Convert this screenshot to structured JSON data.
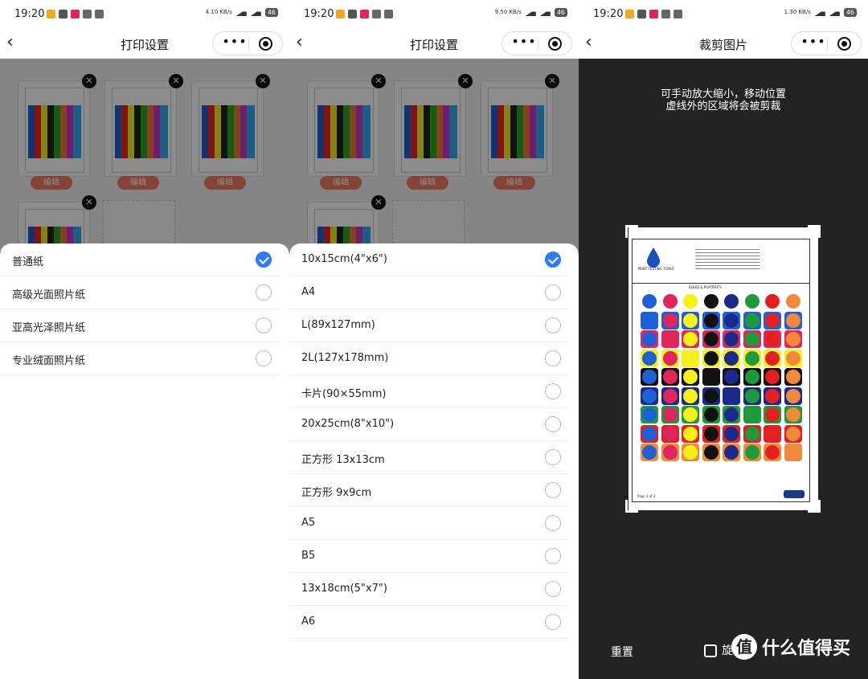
{
  "status_bar": {
    "time": "19:20",
    "battery": "46",
    "net_speed_1": "4.10 KB/s",
    "net_speed_2": "9.50 KB/s",
    "net_speed_3": "1.30 KB/s"
  },
  "panel1": {
    "title": "打印设置",
    "edit_label": "编辑",
    "paper_types": [
      {
        "label": "普通纸",
        "selected": true
      },
      {
        "label": "高级光面照片纸",
        "selected": false
      },
      {
        "label": "亚高光泽照片纸",
        "selected": false
      },
      {
        "label": "专业绒面照片纸",
        "selected": false
      }
    ]
  },
  "panel2": {
    "title": "打印设置",
    "edit_label": "编辑",
    "paper_sizes": [
      {
        "label": "10x15cm(4\"x6\")",
        "selected": true
      },
      {
        "label": "A4",
        "selected": false
      },
      {
        "label": "L(89x127mm)",
        "selected": false
      },
      {
        "label": "2L(127x178mm)",
        "selected": false
      },
      {
        "label": "卡片(90×55mm)",
        "selected": false
      },
      {
        "label": "20x25cm(8\"x10\")",
        "selected": false
      },
      {
        "label": "正方形 13x13cm",
        "selected": false
      },
      {
        "label": "正方形 9x9cm",
        "selected": false
      },
      {
        "label": "A5",
        "selected": false
      },
      {
        "label": "B5",
        "selected": false
      },
      {
        "label": "13x18cm(5\"x7\")",
        "selected": false
      },
      {
        "label": "A6",
        "selected": false
      }
    ]
  },
  "panel3": {
    "title": "裁剪图片",
    "hint_line1": "可手动放大缩小，移动位置",
    "hint_line2": "虚线外的区域将会被剪裁",
    "reset_label": "重置",
    "rotate_label": "旋",
    "doc_brand": "PRINT TESTING TOOLS",
    "doc_section": "BLEED & PORTRAITS",
    "swatch_labels": [
      "CYAN",
      "MAGENTA",
      "YELLOW",
      "BLACK",
      "BLUE",
      "GREEN",
      "RED",
      "ORANGE"
    ],
    "doc_footer": "Page 1 of 3"
  },
  "watermark": {
    "logo": "值",
    "text": "什么值得买"
  },
  "colors": {
    "accent": "#2f7cf6",
    "edit_button": "#f07a5f",
    "crop_bg": "#232323"
  }
}
